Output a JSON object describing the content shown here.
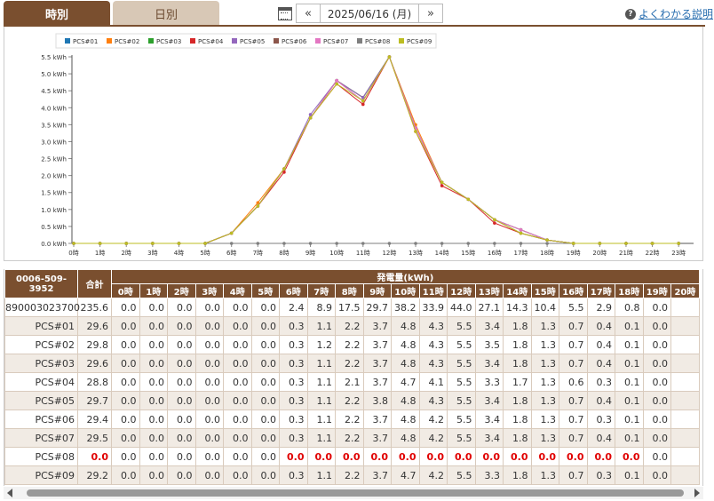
{
  "tabs": {
    "hourly": "時別",
    "daily": "日別"
  },
  "date_nav": {
    "prev": "«",
    "date": "2025/06/16 (月)",
    "next": "»"
  },
  "help": {
    "label": "よくわかる説明"
  },
  "chart_data": {
    "type": "line",
    "categories": [
      "0時",
      "1時",
      "2時",
      "3時",
      "4時",
      "5時",
      "6時",
      "7時",
      "8時",
      "9時",
      "10時",
      "11時",
      "12時",
      "13時",
      "14時",
      "15時",
      "16時",
      "17時",
      "18時",
      "19時",
      "20時",
      "21時",
      "22時",
      "23時"
    ],
    "ylim": [
      0,
      5.5
    ],
    "yticks": [
      "0.0 kWh",
      "0.5 kWh",
      "1.0 kWh",
      "1.5 kWh",
      "2.0 kWh",
      "2.5 kWh",
      "3.0 kWh",
      "3.5 kWh",
      "4.0 kWh",
      "4.5 kWh",
      "5.0 kWh",
      "5.5 kWh"
    ],
    "legend_position": "top",
    "series": [
      {
        "name": "PCS#01",
        "color": "#1f77b4",
        "values": [
          0,
          0,
          0,
          0,
          0,
          0,
          0.3,
          1.1,
          2.2,
          3.7,
          4.8,
          4.3,
          5.5,
          3.4,
          1.8,
          1.3,
          0.7,
          0.4,
          0.1,
          0.0,
          0,
          0,
          0,
          0
        ]
      },
      {
        "name": "PCS#02",
        "color": "#ff7f0e",
        "values": [
          0,
          0,
          0,
          0,
          0,
          0,
          0.3,
          1.2,
          2.2,
          3.7,
          4.8,
          4.3,
          5.5,
          3.5,
          1.8,
          1.3,
          0.7,
          0.4,
          0.1,
          0.0,
          0,
          0,
          0,
          0
        ]
      },
      {
        "name": "PCS#03",
        "color": "#2ca02c",
        "values": [
          0,
          0,
          0,
          0,
          0,
          0,
          0.3,
          1.1,
          2.2,
          3.7,
          4.8,
          4.3,
          5.5,
          3.4,
          1.8,
          1.3,
          0.7,
          0.4,
          0.1,
          0.0,
          0,
          0,
          0,
          0
        ]
      },
      {
        "name": "PCS#04",
        "color": "#d62728",
        "values": [
          0,
          0,
          0,
          0,
          0,
          0,
          0.3,
          1.1,
          2.1,
          3.7,
          4.7,
          4.1,
          5.5,
          3.3,
          1.7,
          1.3,
          0.6,
          0.3,
          0.1,
          0.0,
          0,
          0,
          0,
          0
        ]
      },
      {
        "name": "PCS#05",
        "color": "#9467bd",
        "values": [
          0,
          0,
          0,
          0,
          0,
          0,
          0.3,
          1.1,
          2.2,
          3.8,
          4.8,
          4.3,
          5.5,
          3.4,
          1.8,
          1.3,
          0.7,
          0.4,
          0.1,
          0.0,
          0,
          0,
          0,
          0
        ]
      },
      {
        "name": "PCS#06",
        "color": "#8c564b",
        "values": [
          0,
          0,
          0,
          0,
          0,
          0,
          0.3,
          1.1,
          2.2,
          3.7,
          4.8,
          4.2,
          5.5,
          3.4,
          1.8,
          1.3,
          0.7,
          0.3,
          0.1,
          0.0,
          0,
          0,
          0,
          0
        ]
      },
      {
        "name": "PCS#07",
        "color": "#e377c2",
        "values": [
          0,
          0,
          0,
          0,
          0,
          0,
          0.3,
          1.1,
          2.2,
          3.7,
          4.8,
          4.2,
          5.5,
          3.4,
          1.8,
          1.3,
          0.7,
          0.4,
          0.1,
          0.0,
          0,
          0,
          0,
          0
        ]
      },
      {
        "name": "PCS#08",
        "color": "#7f7f7f",
        "values": [
          0,
          0,
          0,
          0,
          0,
          0,
          0,
          0,
          0,
          0,
          0,
          0,
          0,
          0,
          0,
          0,
          0,
          0,
          0,
          0,
          0,
          0,
          0,
          0
        ]
      },
      {
        "name": "PCS#09",
        "color": "#bcbd22",
        "values": [
          0,
          0,
          0,
          0,
          0,
          0,
          0.3,
          1.1,
          2.2,
          3.7,
          4.7,
          4.2,
          5.5,
          3.3,
          1.8,
          1.3,
          0.7,
          0.3,
          0.1,
          0.0,
          0,
          0,
          0,
          0
        ]
      }
    ]
  },
  "table": {
    "station_id": "0006-509-3952",
    "total_header": "合計",
    "group_header": "発電量(kWh)",
    "hours": [
      "0時",
      "1時",
      "2時",
      "3時",
      "4時",
      "5時",
      "6時",
      "7時",
      "8時",
      "9時",
      "10時",
      "11時",
      "12時",
      "13時",
      "14時",
      "15時",
      "16時",
      "17時",
      "18時",
      "19時",
      "20時"
    ],
    "rows": [
      {
        "label": "890003023700",
        "total": "235.6",
        "cells": [
          "0.0",
          "0.0",
          "0.0",
          "0.0",
          "0.0",
          "0.0",
          "2.4",
          "8.9",
          "17.5",
          "29.7",
          "38.2",
          "33.9",
          "44.0",
          "27.1",
          "14.3",
          "10.4",
          "5.5",
          "2.9",
          "0.8",
          "0.0",
          ""
        ],
        "red": false
      },
      {
        "label": "PCS#01",
        "total": "29.6",
        "cells": [
          "0.0",
          "0.0",
          "0.0",
          "0.0",
          "0.0",
          "0.0",
          "0.3",
          "1.1",
          "2.2",
          "3.7",
          "4.8",
          "4.3",
          "5.5",
          "3.4",
          "1.8",
          "1.3",
          "0.7",
          "0.4",
          "0.1",
          "0.0",
          ""
        ],
        "red": false
      },
      {
        "label": "PCS#02",
        "total": "29.8",
        "cells": [
          "0.0",
          "0.0",
          "0.0",
          "0.0",
          "0.0",
          "0.0",
          "0.3",
          "1.2",
          "2.2",
          "3.7",
          "4.8",
          "4.3",
          "5.5",
          "3.5",
          "1.8",
          "1.3",
          "0.7",
          "0.4",
          "0.1",
          "0.0",
          ""
        ],
        "red": false
      },
      {
        "label": "PCS#03",
        "total": "29.6",
        "cells": [
          "0.0",
          "0.0",
          "0.0",
          "0.0",
          "0.0",
          "0.0",
          "0.3",
          "1.1",
          "2.2",
          "3.7",
          "4.8",
          "4.3",
          "5.5",
          "3.4",
          "1.8",
          "1.3",
          "0.7",
          "0.4",
          "0.1",
          "0.0",
          ""
        ],
        "red": false
      },
      {
        "label": "PCS#04",
        "total": "28.8",
        "cells": [
          "0.0",
          "0.0",
          "0.0",
          "0.0",
          "0.0",
          "0.0",
          "0.3",
          "1.1",
          "2.1",
          "3.7",
          "4.7",
          "4.1",
          "5.5",
          "3.3",
          "1.7",
          "1.3",
          "0.6",
          "0.3",
          "0.1",
          "0.0",
          ""
        ],
        "red": false
      },
      {
        "label": "PCS#05",
        "total": "29.7",
        "cells": [
          "0.0",
          "0.0",
          "0.0",
          "0.0",
          "0.0",
          "0.0",
          "0.3",
          "1.1",
          "2.2",
          "3.8",
          "4.8",
          "4.3",
          "5.5",
          "3.4",
          "1.8",
          "1.3",
          "0.7",
          "0.4",
          "0.1",
          "0.0",
          ""
        ],
        "red": false
      },
      {
        "label": "PCS#06",
        "total": "29.4",
        "cells": [
          "0.0",
          "0.0",
          "0.0",
          "0.0",
          "0.0",
          "0.0",
          "0.3",
          "1.1",
          "2.2",
          "3.7",
          "4.8",
          "4.2",
          "5.5",
          "3.4",
          "1.8",
          "1.3",
          "0.7",
          "0.3",
          "0.1",
          "0.0",
          ""
        ],
        "red": false
      },
      {
        "label": "PCS#07",
        "total": "29.5",
        "cells": [
          "0.0",
          "0.0",
          "0.0",
          "0.0",
          "0.0",
          "0.0",
          "0.3",
          "1.1",
          "2.2",
          "3.7",
          "4.8",
          "4.2",
          "5.5",
          "3.4",
          "1.8",
          "1.3",
          "0.7",
          "0.4",
          "0.1",
          "0.0",
          ""
        ],
        "red": false
      },
      {
        "label": "PCS#08",
        "total": "0.0",
        "cells": [
          "0.0",
          "0.0",
          "0.0",
          "0.0",
          "0.0",
          "0.0",
          "0.0",
          "0.0",
          "0.0",
          "0.0",
          "0.0",
          "0.0",
          "0.0",
          "0.0",
          "0.0",
          "0.0",
          "0.0",
          "0.0",
          "0.0",
          "0.0",
          ""
        ],
        "red": true,
        "red_from": 6
      },
      {
        "label": "PCS#09",
        "total": "29.2",
        "cells": [
          "0.0",
          "0.0",
          "0.0",
          "0.0",
          "0.0",
          "0.0",
          "0.3",
          "1.1",
          "2.2",
          "3.7",
          "4.7",
          "4.2",
          "5.5",
          "3.3",
          "1.8",
          "1.3",
          "0.7",
          "0.3",
          "0.1",
          "0.0",
          ""
        ],
        "red": false
      }
    ]
  }
}
